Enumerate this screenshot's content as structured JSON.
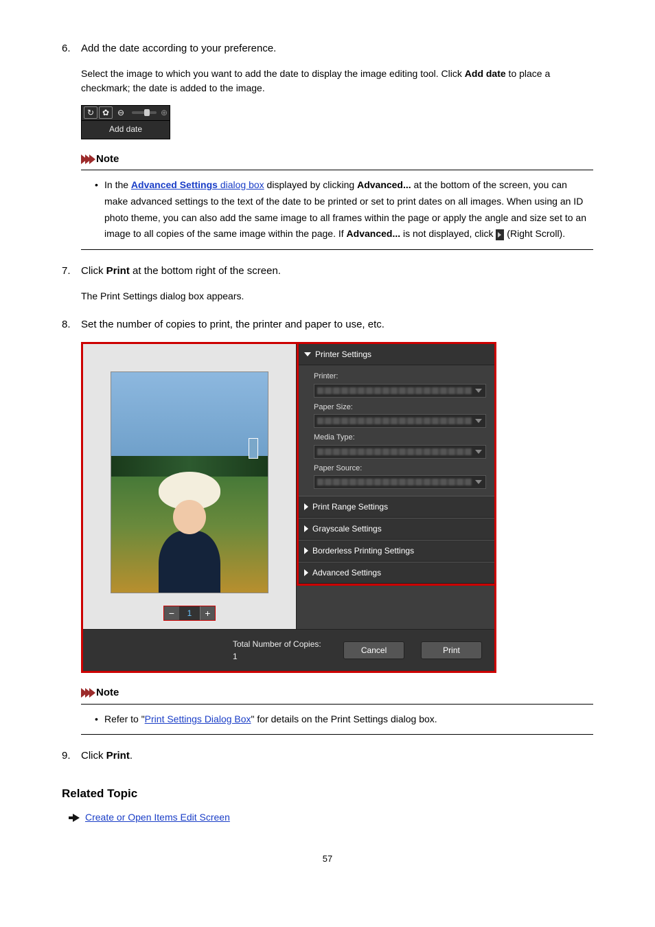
{
  "step6": {
    "num": "6.",
    "title": "Add the date according to your preference.",
    "desc_a": "Select the image to which you want to add the date to display the image editing tool. Click ",
    "desc_bold": "Add date",
    "desc_b": " to place a checkmark; the date is added to the image.",
    "widget_label": "Add date"
  },
  "note1": {
    "heading": "Note",
    "prefix": "In the ",
    "link": "Advanced Settings",
    "link_suffix": " dialog box",
    "mid": " displayed by clicking ",
    "bold1": "Advanced...",
    "after_bold1": " at the bottom of the screen, you can make advanced settings to the text of the date to be printed or set to print dates on all images. When using an ID photo theme, you can also add the same image to all frames within the page or apply the angle and size set to an image to all copies of the same image within the page. If ",
    "bold2": "Advanced...",
    "after_bold2": " is not displayed, click ",
    "tail": " (Right Scroll)."
  },
  "step7": {
    "num": "7.",
    "title_a": "Click ",
    "title_bold": "Print",
    "title_b": " at the bottom right of the screen.",
    "desc": "The Print Settings dialog box appears."
  },
  "step8": {
    "num": "8.",
    "title": "Set the number of copies to print, the printer and paper to use, etc."
  },
  "dialog": {
    "printer_settings": "Printer Settings",
    "printer": "Printer:",
    "paper_size": "Paper Size:",
    "media_type": "Media Type:",
    "paper_source": "Paper Source:",
    "print_range": "Print Range Settings",
    "grayscale": "Grayscale Settings",
    "borderless": "Borderless Printing Settings",
    "advanced": "Advanced Settings",
    "pager_minus": "−",
    "pager_num": "1",
    "pager_plus": "+",
    "total_copies": "Total Number of Copies: 1",
    "cancel": "Cancel",
    "print": "Print"
  },
  "note2": {
    "heading": "Note",
    "prefix": "Refer to \"",
    "link": "Print Settings Dialog Box",
    "suffix": "\" for details on the Print Settings dialog box."
  },
  "step9": {
    "num": "9.",
    "title_a": "Click ",
    "title_bold": "Print",
    "title_b": "."
  },
  "related": {
    "heading": "Related Topic",
    "link": "Create or Open Items Edit Screen"
  },
  "page_number": "57"
}
